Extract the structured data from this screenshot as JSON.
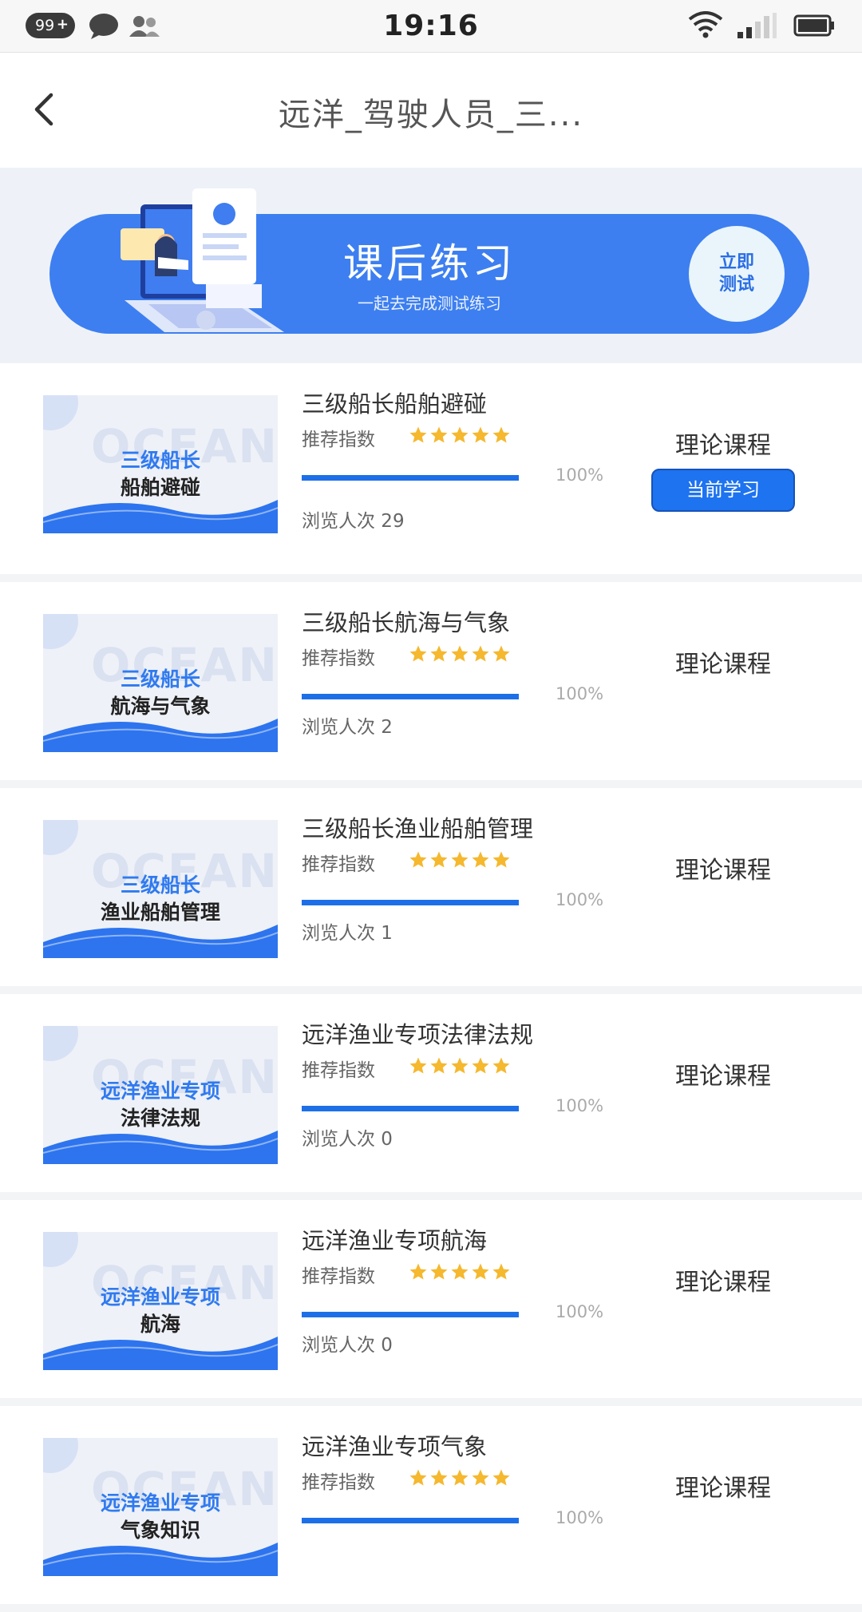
{
  "status_bar": {
    "notification_count": "99",
    "time": "19:16"
  },
  "nav": {
    "title": "远洋_驾驶人员_三..."
  },
  "banner": {
    "title": "课后练习",
    "subtitle": "一起去完成测试练习",
    "button_label": "立即\n测试",
    "color": "#3d7ff0"
  },
  "common": {
    "rating_label": "推荐指数",
    "stars": 5,
    "star_color": "#f5b82e",
    "progress_color": "#1d6fe8"
  },
  "courses": [
    {
      "name": "三级船长船舶避碰",
      "thumb_line1": "三级船长",
      "thumb_line2": "船舶避碰",
      "progress": 100,
      "progress_text": "100%",
      "views": "浏览人次 29",
      "type": "理论课程",
      "current_label": "当前学习"
    },
    {
      "name": "三级船长航海与气象",
      "thumb_line1": "三级船长",
      "thumb_line2": "航海与气象",
      "progress": 100,
      "progress_text": "100%",
      "views": "浏览人次 2",
      "type": "理论课程"
    },
    {
      "name": "三级船长渔业船舶管理",
      "thumb_line1": "三级船长",
      "thumb_line2": "渔业船舶管理",
      "progress": 100,
      "progress_text": "100%",
      "views": "浏览人次 1",
      "type": "理论课程"
    },
    {
      "name": "远洋渔业专项法律法规",
      "thumb_line1": "远洋渔业专项",
      "thumb_line2": "法律法规",
      "progress": 100,
      "progress_text": "100%",
      "views": "浏览人次 0",
      "type": "理论课程"
    },
    {
      "name": "远洋渔业专项航海",
      "thumb_line1": "远洋渔业专项",
      "thumb_line2": "航海",
      "progress": 100,
      "progress_text": "100%",
      "views": "浏览人次 0",
      "type": "理论课程"
    },
    {
      "name": "远洋渔业专项气象",
      "thumb_line1": "远洋渔业专项",
      "thumb_line2": "气象知识",
      "progress": 100,
      "progress_text": "100%",
      "views": "",
      "type": "理论课程"
    }
  ]
}
